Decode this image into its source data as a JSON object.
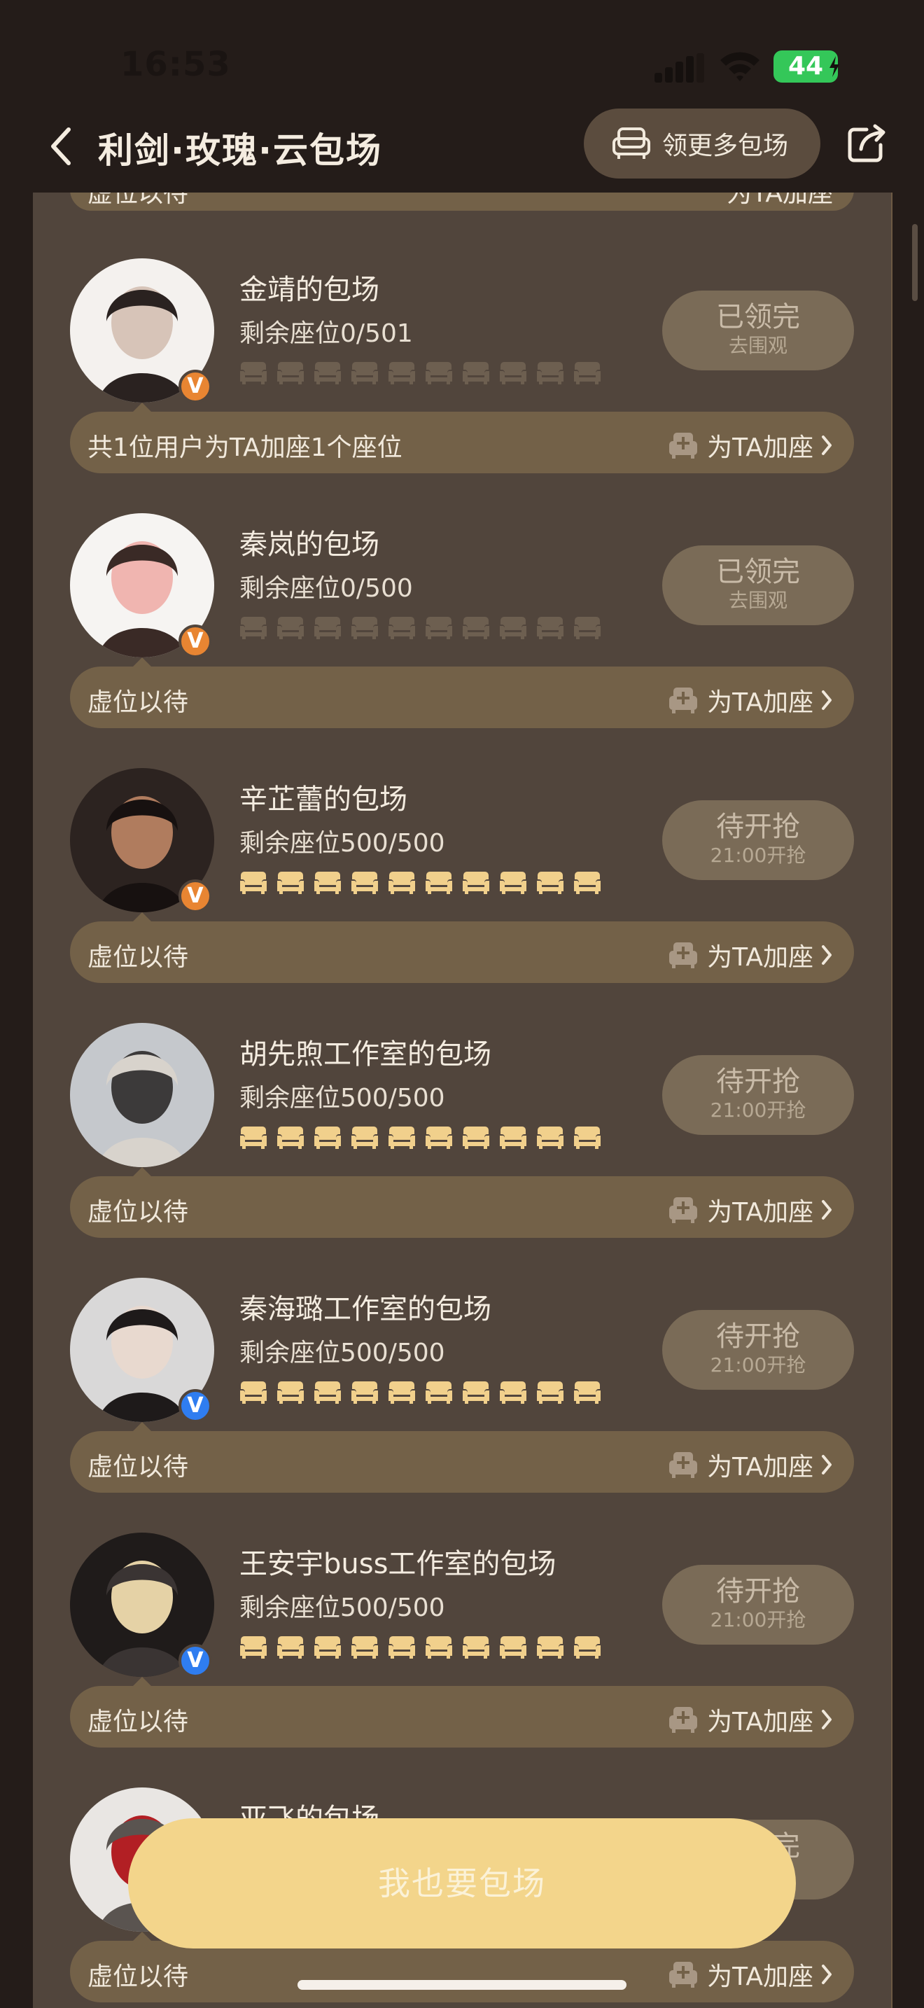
{
  "status_bar": {
    "time": "16:53",
    "battery": "44"
  },
  "nav": {
    "title": "利剑·玫瑰·云包场",
    "more_button": "领更多包场"
  },
  "top_strip": {
    "text": "虚位以待",
    "add_label": "为TA加座"
  },
  "colors": {
    "seat_filled": "#f1d08c",
    "seat_empty": "#6d5f50",
    "cta": "#f3d58b",
    "badge_orange": "#e88532",
    "badge_blue": "#2f7df0"
  },
  "groups": [
    {
      "name": "金靖的包场",
      "seats": "剩余座位0/501",
      "status": "已领完",
      "status_sub": "去围观",
      "strip_text": "共1位用户为TA加座1个座位",
      "add_label": "为TA加座",
      "badge": "V",
      "badge_color": "orange",
      "seats_available": false
    },
    {
      "name": "秦岚的包场",
      "seats": "剩余座位0/500",
      "status": "已领完",
      "status_sub": "去围观",
      "strip_text": "虚位以待",
      "add_label": "为TA加座",
      "badge": "V",
      "badge_color": "orange",
      "seats_available": false
    },
    {
      "name": "辛芷蕾的包场",
      "seats": "剩余座位500/500",
      "status": "待开抢",
      "status_sub": "21:00开抢",
      "strip_text": "虚位以待",
      "add_label": "为TA加座",
      "badge": "V",
      "badge_color": "orange",
      "seats_available": true
    },
    {
      "name": "胡先煦工作室的包场",
      "seats": "剩余座位500/500",
      "status": "待开抢",
      "status_sub": "21:00开抢",
      "strip_text": "虚位以待",
      "add_label": "为TA加座",
      "badge": "",
      "badge_color": "none",
      "seats_available": true
    },
    {
      "name": "秦海璐工作室的包场",
      "seats": "剩余座位500/500",
      "status": "待开抢",
      "status_sub": "21:00开抢",
      "strip_text": "虚位以待",
      "add_label": "为TA加座",
      "badge": "V",
      "badge_color": "blue",
      "seats_available": true
    },
    {
      "name": "王安宇buss工作室的包场",
      "seats": "剩余座位500/500",
      "status": "待开抢",
      "status_sub": "21:00开抢",
      "strip_text": "虚位以待",
      "add_label": "为TA加座",
      "badge": "V",
      "badge_color": "blue",
      "seats_available": true
    },
    {
      "name": "亚飞的包场",
      "seats": "",
      "status": "已领完",
      "status_sub": "",
      "strip_text": "虚位以待",
      "add_label": "为TA加座",
      "badge": "",
      "badge_color": "none",
      "seats_available": false
    }
  ],
  "cta": {
    "label": "我也要包场"
  }
}
